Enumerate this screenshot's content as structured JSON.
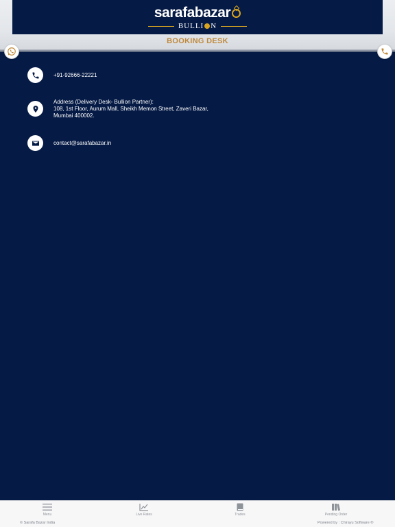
{
  "header": {
    "logo_main": "sarafabazar",
    "logo_sub_left": "BULLI",
    "logo_sub_right": "N",
    "title": "BOOKING DESK"
  },
  "contacts": [
    {
      "icon": "phone-icon",
      "text": "+91-92666-22221"
    },
    {
      "icon": "location-pin-icon",
      "label": "Address (Delivery Desk- Bullion Partner):",
      "text": "108, 1st Floor, Aurum Mall, Sheikh Memon Street, Zaveri Bazar, Mumbai 400002."
    },
    {
      "icon": "mail-icon",
      "text": "contact@sarafabazar.in"
    }
  ],
  "bottom_nav": [
    {
      "label": "Menu",
      "icon": "hamburger-icon"
    },
    {
      "label": "Live Rates",
      "icon": "line-chart-icon"
    },
    {
      "label": "Trades",
      "icon": "book-icon"
    },
    {
      "label": "Pending Order",
      "icon": "books-icon"
    }
  ],
  "footer": {
    "left": "© Sarafa Bazar India",
    "right": "Powered by : Chirayu Software ®"
  },
  "colors": {
    "background": "#051a45",
    "accent": "#c0893a",
    "gold": "#d9a520",
    "whatsapp": "#25d366"
  }
}
